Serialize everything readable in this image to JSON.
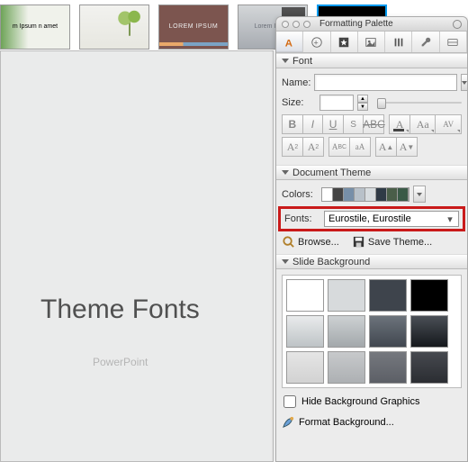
{
  "thumbs": [
    {
      "label": "m Ipsum\nn amet"
    },
    {
      "label": ""
    },
    {
      "label": "LOREM IPSUM"
    },
    {
      "label": "Lorem Ipsum"
    },
    {
      "label": ""
    }
  ],
  "canvas": {
    "title": "Theme Fonts",
    "subtitle": "PowerPoint"
  },
  "palette": {
    "title": "Formatting Palette",
    "sections": {
      "font": {
        "heading": "Font",
        "name_label": "Name:",
        "name_value": "",
        "size_label": "Size:",
        "size_value": ""
      },
      "theme": {
        "heading": "Document Theme",
        "colors_label": "Colors:",
        "color_swatches": [
          "#ffffff",
          "#444444",
          "#778fa8",
          "#b8c1c9",
          "#d8dde0",
          "#2f3a46",
          "#4a5e49",
          "#3a5a47"
        ],
        "fonts_label": "Fonts:",
        "fonts_value": "Eurostile, Eurostile",
        "browse_label": "Browse...",
        "save_label": "Save Theme..."
      },
      "bg": {
        "heading": "Slide Background",
        "swatches": [
          "#ffffff",
          "#d7dadc",
          "#3e444c",
          "#000000",
          "linear-gradient(#e9ebec,#bec3c6)",
          "linear-gradient(#cdd1d3,#a3a8ab)",
          "linear-gradient(#6c737b,#414750)",
          "linear-gradient(#4a4f56,#15181c)",
          "linear-gradient(#e5e5e5,#d2d2d2)",
          "linear-gradient(#c7c9cb,#adb0b3)",
          "linear-gradient(#75787e,#5c5f66)",
          "linear-gradient(#46494f,#2b2d32)"
        ],
        "hide_label": "Hide Background Graphics",
        "format_label": "Format Background..."
      }
    }
  }
}
